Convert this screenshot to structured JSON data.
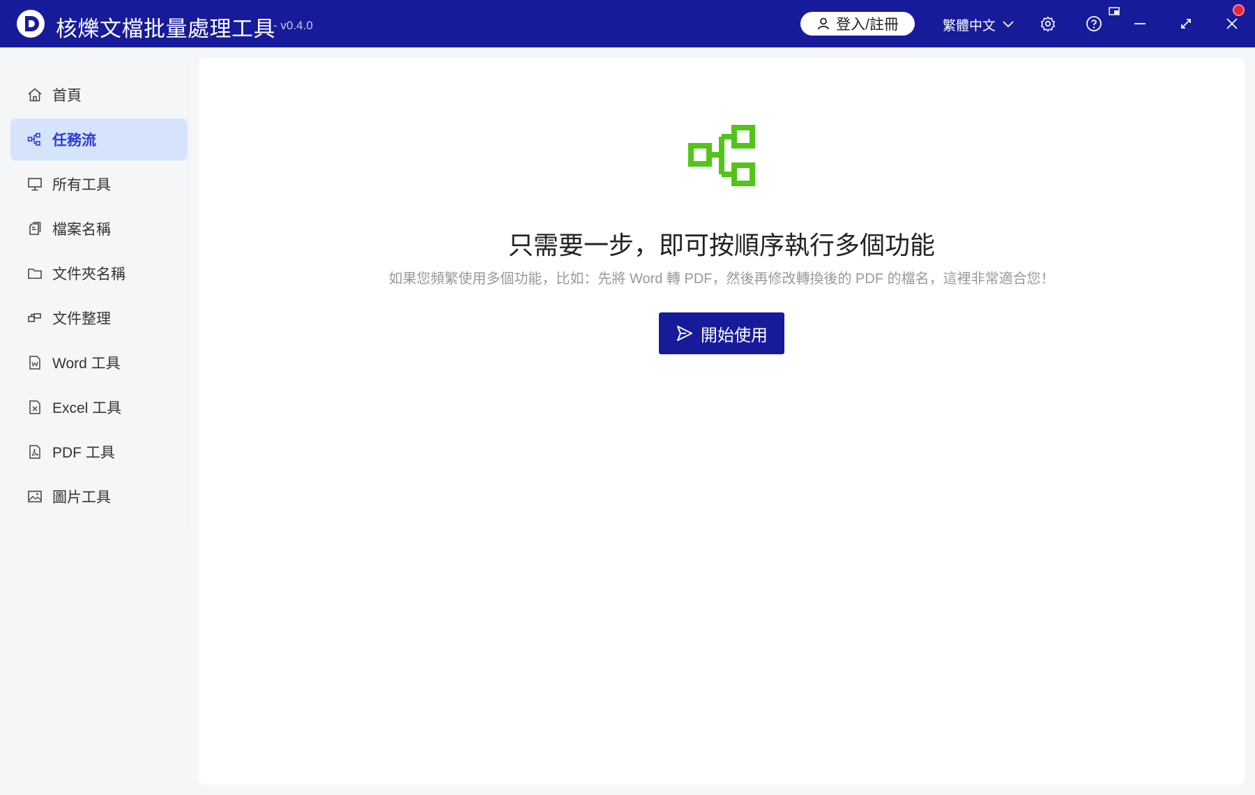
{
  "titlebar": {
    "app_title": "核爍文檔批量處理工具",
    "version": "- v0.4.0",
    "login_label": "登入/註冊",
    "language": "繁體中文",
    "accent": "#171b9a"
  },
  "sidebar": {
    "active_color": "#2a3bd6",
    "items": [
      {
        "label": "首頁",
        "icon": "home-icon"
      },
      {
        "label": "任務流",
        "icon": "workflow-icon"
      },
      {
        "label": "所有工具",
        "icon": "monitor-icon"
      },
      {
        "label": "檔案名稱",
        "icon": "file-copy-icon"
      },
      {
        "label": "文件夾名稱",
        "icon": "folder-icon"
      },
      {
        "label": "文件整理",
        "icon": "organize-icon"
      },
      {
        "label": "Word 工具",
        "icon": "word-file-icon"
      },
      {
        "label": "Excel 工具",
        "icon": "excel-file-icon"
      },
      {
        "label": "PDF 工具",
        "icon": "pdf-file-icon"
      },
      {
        "label": "圖片工具",
        "icon": "image-icon"
      }
    ]
  },
  "main": {
    "headline": "只需要一步，即可按順序執行多個功能",
    "subline": "如果您頻繁使用多個功能，比如：先將 Word 轉 PDF，然後再修改轉換後的 PDF 的檔名，這裡非常適合您！",
    "start_label": "開始使用",
    "icon": "workflow-icon",
    "icon_color": "#52c41a"
  }
}
